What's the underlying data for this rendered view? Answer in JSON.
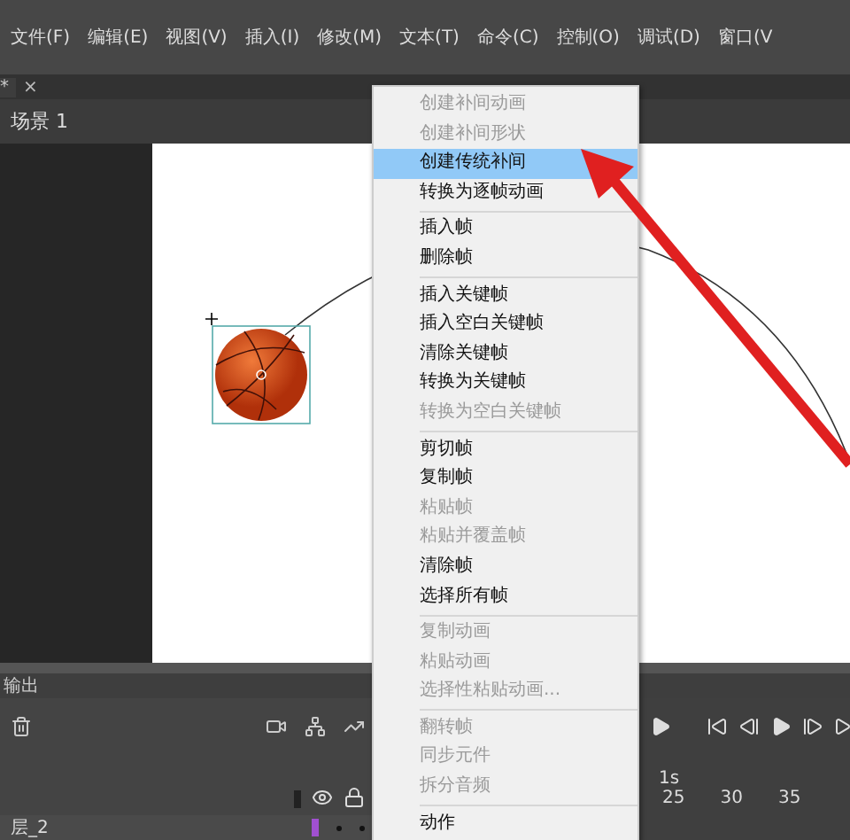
{
  "menubar": {
    "items": [
      "文件(F)",
      "编辑(E)",
      "视图(V)",
      "插入(I)",
      "修改(M)",
      "文本(T)",
      "命令(C)",
      "控制(O)",
      "调试(D)",
      "窗口(V"
    ]
  },
  "document_tab": {
    "label": "*",
    "close": "×"
  },
  "scene_bar": {
    "label": "场景 1"
  },
  "context_menu": {
    "items": [
      {
        "kind": "item",
        "label": "创建补间动画",
        "disabled": true,
        "selected": false
      },
      {
        "kind": "item",
        "label": "创建补间形状",
        "disabled": true,
        "selected": false
      },
      {
        "kind": "item",
        "label": "创建传统补间",
        "disabled": false,
        "selected": true
      },
      {
        "kind": "item",
        "label": "转换为逐帧动画",
        "disabled": false,
        "selected": false
      },
      {
        "kind": "separator"
      },
      {
        "kind": "item",
        "label": "插入帧",
        "disabled": false,
        "selected": false
      },
      {
        "kind": "item",
        "label": "删除帧",
        "disabled": false,
        "selected": false
      },
      {
        "kind": "separator"
      },
      {
        "kind": "item",
        "label": "插入关键帧",
        "disabled": false,
        "selected": false
      },
      {
        "kind": "item",
        "label": "插入空白关键帧",
        "disabled": false,
        "selected": false
      },
      {
        "kind": "item",
        "label": "清除关键帧",
        "disabled": false,
        "selected": false
      },
      {
        "kind": "item",
        "label": "转换为关键帧",
        "disabled": false,
        "selected": false
      },
      {
        "kind": "item",
        "label": "转换为空白关键帧",
        "disabled": true,
        "selected": false
      },
      {
        "kind": "separator"
      },
      {
        "kind": "item",
        "label": "剪切帧",
        "disabled": false,
        "selected": false
      },
      {
        "kind": "item",
        "label": "复制帧",
        "disabled": false,
        "selected": false
      },
      {
        "kind": "item",
        "label": "粘贴帧",
        "disabled": true,
        "selected": false
      },
      {
        "kind": "item",
        "label": "粘贴并覆盖帧",
        "disabled": true,
        "selected": false
      },
      {
        "kind": "item",
        "label": "清除帧",
        "disabled": false,
        "selected": false
      },
      {
        "kind": "item",
        "label": "选择所有帧",
        "disabled": false,
        "selected": false
      },
      {
        "kind": "separator"
      },
      {
        "kind": "item",
        "label": "复制动画",
        "disabled": true,
        "selected": false
      },
      {
        "kind": "item",
        "label": "粘贴动画",
        "disabled": true,
        "selected": false
      },
      {
        "kind": "item",
        "label": "选择性粘贴动画...",
        "disabled": true,
        "selected": false
      },
      {
        "kind": "separator"
      },
      {
        "kind": "item",
        "label": "翻转帧",
        "disabled": true,
        "selected": false
      },
      {
        "kind": "item",
        "label": "同步元件",
        "disabled": true,
        "selected": false
      },
      {
        "kind": "item",
        "label": "拆分音频",
        "disabled": true,
        "selected": false
      },
      {
        "kind": "separator"
      },
      {
        "kind": "item",
        "label": "动作",
        "disabled": false,
        "selected": false
      }
    ]
  },
  "output_panel": {
    "title": "输出"
  },
  "timeline": {
    "ruler_label": "1s",
    "ticks": [
      "25",
      "30",
      "35"
    ],
    "layers": [
      {
        "name": "层_2",
        "selected": false
      }
    ]
  }
}
